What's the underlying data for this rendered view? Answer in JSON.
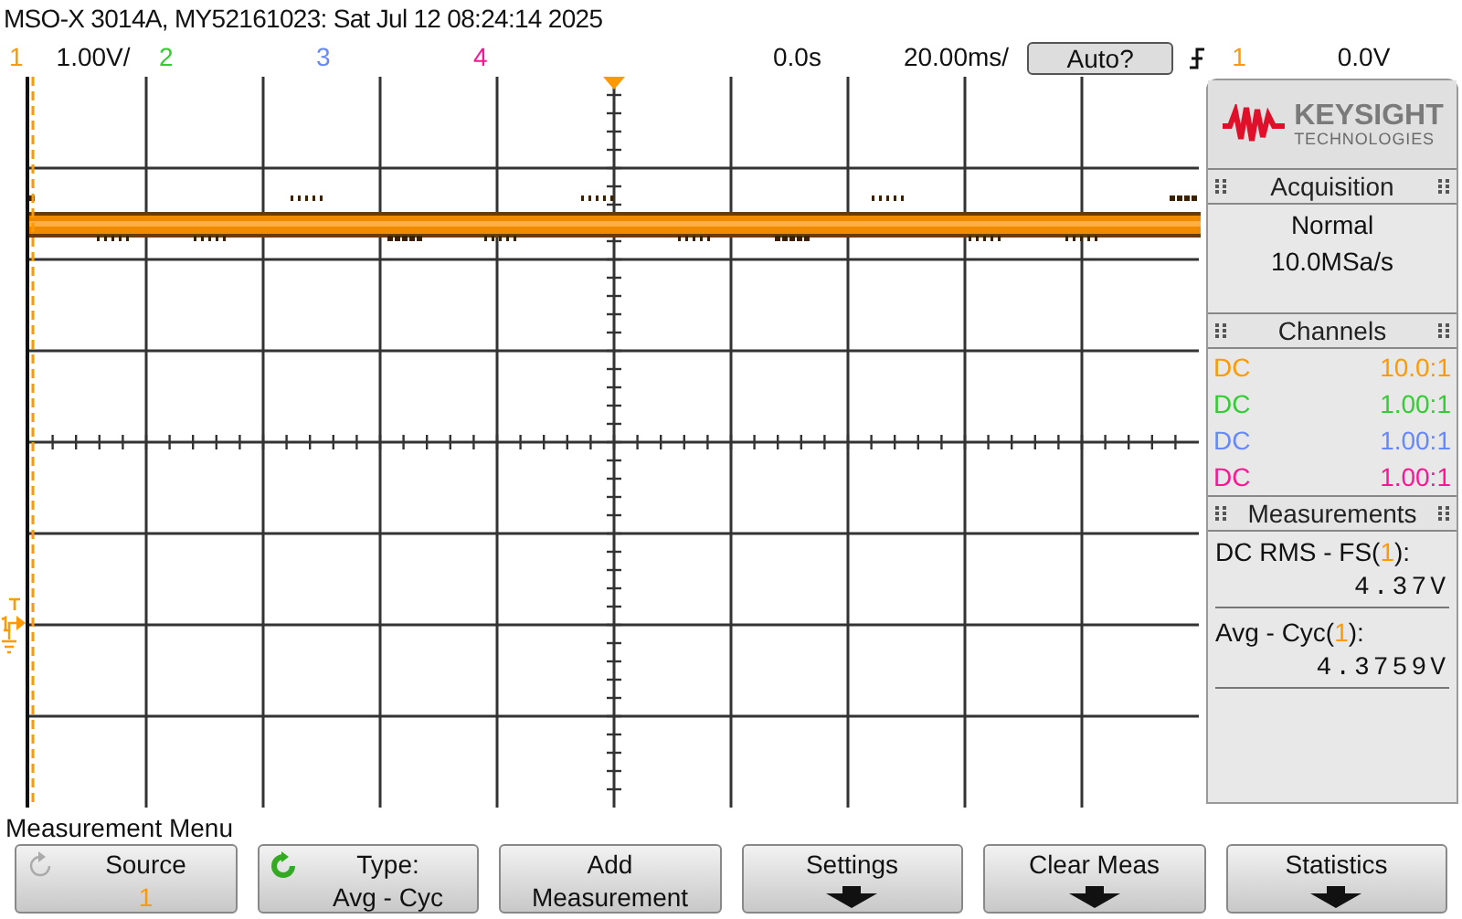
{
  "title": "MSO-X 3014A, MY52161023: Sat Jul 12 08:24:14 2025",
  "channels": [
    {
      "number": "1",
      "scale": "1.00V/",
      "color": "#ff9900"
    },
    {
      "number": "2",
      "color": "#33cc33"
    },
    {
      "number": "3",
      "color": "#6688ff"
    },
    {
      "number": "4",
      "color": "#ff1493"
    }
  ],
  "time_offset": "0.0s",
  "timebase": "20.00ms/",
  "run_button": "Auto?",
  "trigger": {
    "source": "1",
    "color": "#ff9900",
    "level": "0.0V"
  },
  "logo": {
    "name": "KEYSIGHT",
    "sub": "TECHNOLOGIES"
  },
  "acquisition": {
    "title": "Acquisition",
    "mode": "Normal",
    "rate": "10.0MSa/s"
  },
  "channel_panel": {
    "title": "Channels",
    "rows": [
      {
        "coupling": "DC",
        "probe": "10.0:1",
        "color": "#ff9900"
      },
      {
        "coupling": "DC",
        "probe": "1.00:1",
        "color": "#33cc33"
      },
      {
        "coupling": "DC",
        "probe": "1.00:1",
        "color": "#6688ff"
      },
      {
        "coupling": "DC",
        "probe": "1.00:1",
        "color": "#ff1493"
      }
    ]
  },
  "measurements": {
    "title": "Measurements",
    "items": [
      {
        "prefix": "DC RMS - FS(",
        "source": "1",
        "suffix": "):",
        "value": "4.37V"
      },
      {
        "prefix": "Avg - Cyc(",
        "source": "1",
        "suffix": "):",
        "value": "4.3759V"
      }
    ]
  },
  "menu_title": "Measurement Menu",
  "softkeys": [
    {
      "kind": "cycle",
      "label": "Source",
      "value": "1",
      "disabled": true
    },
    {
      "kind": "cycle",
      "label": "Type:",
      "value": "Avg - Cyc",
      "disabled": false
    },
    {
      "kind": "text",
      "label": "Add",
      "value": "Measurement"
    },
    {
      "kind": "submenu",
      "label": "Settings"
    },
    {
      "kind": "submenu",
      "label": "Clear Meas"
    },
    {
      "kind": "submenu",
      "label": "Statistics"
    }
  ]
}
